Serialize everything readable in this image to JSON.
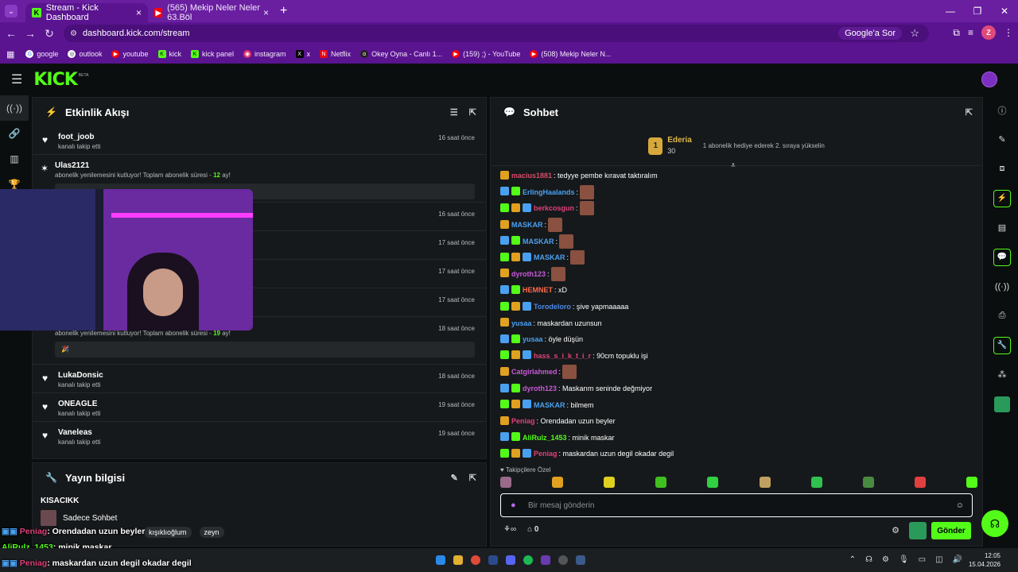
{
  "browser": {
    "tabs": [
      {
        "title": "Stream - Kick Dashboard",
        "active": true
      },
      {
        "title": "(565) Mekip Neler Neler 63.Böl",
        "active": false
      }
    ],
    "url": "dashboard.kick.com/stream",
    "google_search_label": "Google'a Sor",
    "profile_letter": "Z",
    "bookmarks": [
      "google",
      "outlook",
      "youtube",
      "kick",
      "kick panel",
      "instagram",
      "x",
      "Netflix",
      "Okey Oyna - Canlı 1...",
      "(159) ;) - YouTube",
      "(508) Mekip Neler N..."
    ]
  },
  "kick": {
    "logo": "KICK",
    "beta": "BETA"
  },
  "activity": {
    "title": "Etkinlik Akışı",
    "events": [
      {
        "name": "foot_joob",
        "sub": "kanalı takip etti",
        "time": "16 saat önce"
      },
      {
        "name": "Ulas2121",
        "sub": "abonelik yenilemesini kutluyor! Toplam abonelik süresi -",
        "months": "12",
        "sub_suffix": "ay!",
        "time": "16 saat önce"
      },
      {
        "time": "16 saat önce"
      },
      {
        "time": "17 saat önce"
      },
      {
        "time": "17 saat önce"
      },
      {
        "time": "17 saat önce"
      },
      {
        "sub": "abonelik yenilemesini kutluyor! Toplam abonelik süresi -",
        "months": "19",
        "sub_suffix": "ay!",
        "time": "18 saat önce"
      },
      {
        "name": "LukaDonsic",
        "sub": "kanalı takip etti",
        "time": "18 saat önce"
      },
      {
        "name": "ONEAGLE",
        "sub": "kanalı takip etti",
        "time": "19 saat önce"
      },
      {
        "name": "Vaneleas",
        "sub": "kanalı takip etti",
        "time": "19 saat önce"
      }
    ]
  },
  "stream_info": {
    "title": "Yayın bilgisi",
    "stream_title": "KISACIKK",
    "category": "Sadece Sohbet",
    "tags": [
      "zeyn"
    ],
    "tag_partial": "kışıklıoğlum"
  },
  "chat": {
    "title": "Sohbet",
    "pinned": {
      "rank": "1",
      "user": "Ederia",
      "count": "30",
      "note": "1 abonelik hediye ederek 2. sıraya yükselin"
    },
    "messages": [
      {
        "user": "macius1881",
        "color": "#d94a6a",
        "text": ": tedyye pembe kıravat taktıralım"
      },
      {
        "user": "ErlingHaalands",
        "color": "#4aa0f0",
        "text": ":"
      },
      {
        "user": "berkcosgun",
        "color": "#e0407a",
        "text": ":"
      },
      {
        "user": "MASKAR",
        "color": "#4aa0f0",
        "text": ":"
      },
      {
        "user": "MASKAR",
        "color": "#4aa0f0",
        "text": ":"
      },
      {
        "user": "MASKAR",
        "color": "#4aa0f0",
        "text": ":"
      },
      {
        "user": "dyroth123",
        "color": "#c85ad8",
        "text": ":"
      },
      {
        "user": "HEMNET",
        "color": "#ff6a4a",
        "text": ": xD"
      },
      {
        "user": "Torodeloro",
        "color": "#4a8ae8",
        "text": ": şive yapmaaaaa"
      },
      {
        "user": "yusaa",
        "color": "#4aa0f0",
        "text": ": maskardan uzunsun"
      },
      {
        "user": "yusaa",
        "color": "#4aa0f0",
        "text": ": öyle düşün"
      },
      {
        "user": "hass_s_i_k_t_i_r",
        "color": "#e0407a",
        "text": ": 90cm topuklu işi"
      },
      {
        "user": "Catgirlahmed",
        "color": "#c85ad8",
        "text": ":"
      },
      {
        "user": "dyroth123",
        "color": "#c85ad8",
        "text": ": Maskarım seninde değmiyor"
      },
      {
        "user": "MASKAR",
        "color": "#4aa0f0",
        "text": ": bilmem"
      },
      {
        "user": "Peniag",
        "color": "#e0407a",
        "text": ": Orendadan uzun beyler"
      },
      {
        "user": "AliRulz_1453",
        "color": "#53fc18",
        "text": ": minik maskar"
      },
      {
        "user": "Peniag",
        "color": "#e0407a",
        "text": ": maskardan uzun degil okadar degil"
      }
    ],
    "followers_only": "Takipçilere Özel",
    "input_placeholder": "Bir mesaj gönderin",
    "count": "0",
    "send_label": "Gönder"
  },
  "overlay": [
    {
      "user": "Peniag",
      "text": ": Orendadan uzun beyler"
    },
    {
      "user": "AliRulz_1453",
      "text": ": minik maskar"
    },
    {
      "user": "Peniag",
      "text": ": maskardan uzun degil okadar degil"
    }
  ],
  "taskbar": {
    "time": "12:05",
    "date": "15.04.2026"
  }
}
